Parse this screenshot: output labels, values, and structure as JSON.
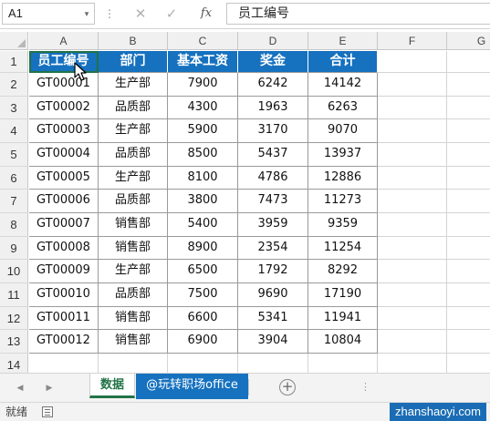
{
  "formula_bar": {
    "name_box": "A1",
    "dropdown_icon": "▾",
    "dots_icon": "⋮",
    "cancel_icon": "✕",
    "confirm_icon": "✓",
    "fx_label": "fx",
    "content": "员工编号"
  },
  "columns": [
    "A",
    "B",
    "C",
    "D",
    "E",
    "F",
    "G"
  ],
  "row_numbers": [
    "1",
    "2",
    "3",
    "4",
    "5",
    "6",
    "7",
    "8",
    "9",
    "10",
    "11",
    "12",
    "13",
    "14"
  ],
  "table": {
    "headers": [
      "员工编号",
      "部门",
      "基本工资",
      "奖金",
      "合计"
    ],
    "rows": [
      [
        "GT00001",
        "生产部",
        "7900",
        "6242",
        "14142"
      ],
      [
        "GT00002",
        "品质部",
        "4300",
        "1963",
        "6263"
      ],
      [
        "GT00003",
        "生产部",
        "5900",
        "3170",
        "9070"
      ],
      [
        "GT00004",
        "品质部",
        "8500",
        "5437",
        "13937"
      ],
      [
        "GT00005",
        "生产部",
        "8100",
        "4786",
        "12886"
      ],
      [
        "GT00006",
        "品质部",
        "3800",
        "7473",
        "11273"
      ],
      [
        "GT00007",
        "销售部",
        "5400",
        "3959",
        "9359"
      ],
      [
        "GT00008",
        "销售部",
        "8900",
        "2354",
        "11254"
      ],
      [
        "GT00009",
        "生产部",
        "6500",
        "1792",
        "8292"
      ],
      [
        "GT00010",
        "品质部",
        "7500",
        "9690",
        "17190"
      ],
      [
        "GT00011",
        "销售部",
        "6600",
        "5341",
        "11941"
      ],
      [
        "GT00012",
        "销售部",
        "6900",
        "3904",
        "10804"
      ]
    ]
  },
  "tabs": {
    "prev_icon": "◀",
    "next_icon": "▶",
    "sheets": [
      "数据",
      "@玩转职场office"
    ],
    "active_index": 0,
    "add_icon": "+",
    "scroll_dots": "⋮"
  },
  "status": {
    "ready": "就绪"
  },
  "watermark": "zhanshaoyi.com",
  "colors": {
    "header_fill": "#1671bf",
    "header_text": "#ffffff",
    "active_tab_accent": "#217346",
    "watermark_bg": "#1a6db5"
  }
}
